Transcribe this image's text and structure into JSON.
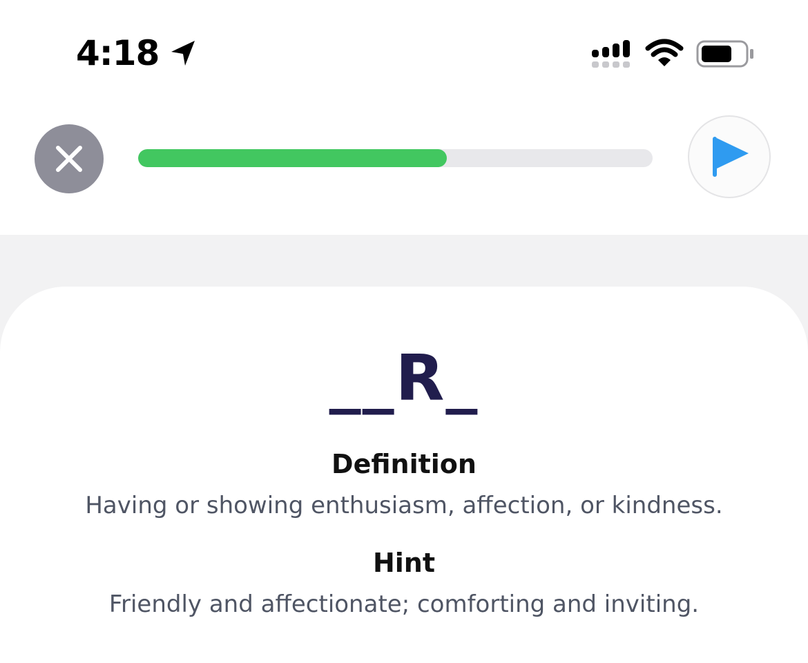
{
  "status_bar": {
    "time": "4:18",
    "icons": [
      "location-arrow-icon",
      "cellular-signal-icon",
      "wifi-icon",
      "battery-icon"
    ]
  },
  "toolbar": {
    "close_icon": "close-icon",
    "flag_icon": "flag-icon",
    "progress_fraction": 0.6
  },
  "card": {
    "puzzle": "__R_",
    "definition_title": "Definition",
    "definition_text": "Having or showing enthusiasm, affection, or kindness.",
    "hint_title": "Hint",
    "hint_text": "Friendly and affectionate; comforting and inviting."
  },
  "colors": {
    "progress_fill": "#42c760",
    "progress_track": "#e8e8eb",
    "close_button_bg": "#8e8e99",
    "flag_blue": "#2f9bf0",
    "puzzle_text": "#211d4d",
    "body_text": "#4f5564",
    "background_band": "#f2f2f3"
  }
}
